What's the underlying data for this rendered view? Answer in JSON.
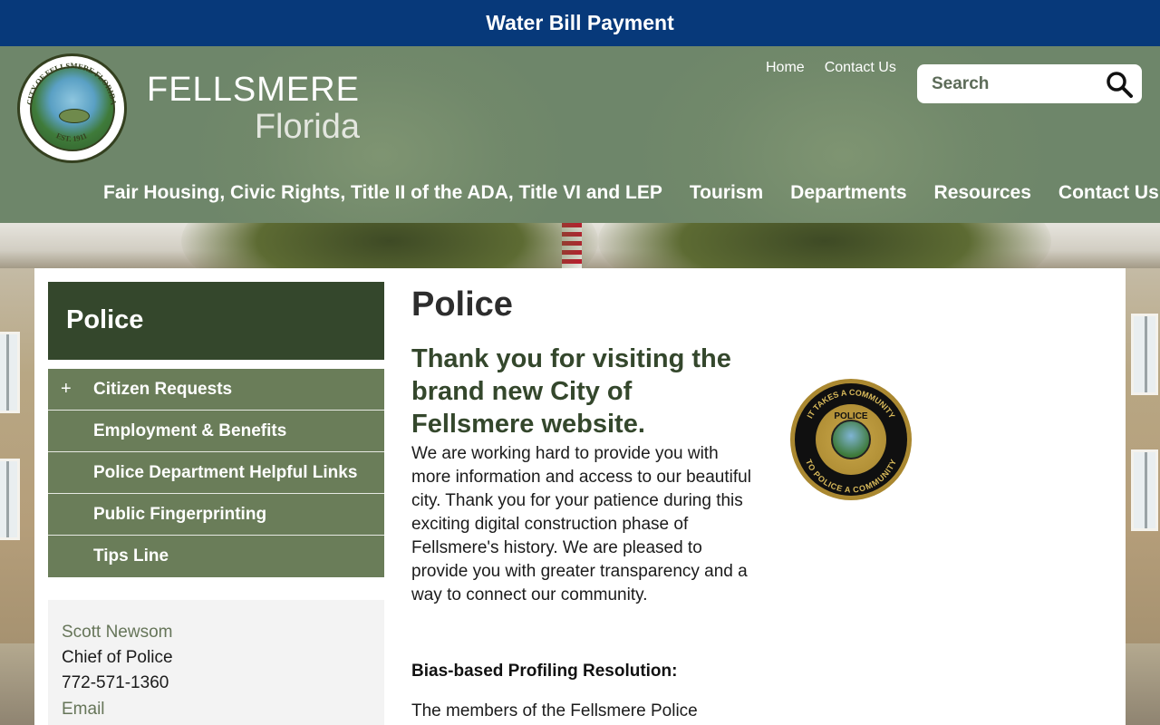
{
  "topbar": {
    "link": "Water Bill Payment"
  },
  "site": {
    "title_line1": "FELLSMERE",
    "title_line2": "Florida"
  },
  "utility_nav": [
    "Home",
    "Contact Us"
  ],
  "search": {
    "placeholder": "Search"
  },
  "main_nav": [
    "Fair Housing, Civic Rights, Title II of the ADA, Title VI and LEP",
    "Tourism",
    "Departments",
    "Resources",
    "Contact Us"
  ],
  "sidebar": {
    "heading": "Police",
    "items": [
      {
        "label": "Citizen Requests",
        "expander": "+"
      },
      {
        "label": "Employment & Benefits"
      },
      {
        "label": "Police Department Helpful Links"
      },
      {
        "label": "Public Fingerprinting"
      },
      {
        "label": "Tips Line"
      }
    ],
    "contact": {
      "name": "Scott Newsom",
      "title": "Chief of Police",
      "phone": "772-571-1360",
      "email_label": "Email"
    }
  },
  "content": {
    "page_title": "Police",
    "subheading": "Thank you for visiting the brand new City of Fellsmere website.",
    "intro": "We are working hard to provide you with more information and access to our beautiful city.  Thank you for your patience during this exciting digital construction phase of Fellsmere's history.   We are pleased to provide you with greater transparency and a way to connect our community.",
    "bias_heading": "Bias-based Profiling Resolution:",
    "bias_text_partial": "The members of the Fellsmere Police"
  },
  "badge": {
    "top_text": "IT TAKES A COMMUNITY",
    "bottom_text": "TO POLICE A COMMUNITY",
    "center_text": "POLICE"
  },
  "seal": {
    "text": "CITY OF FELLSMERE FLORIDA",
    "est": "EST. 1911"
  }
}
